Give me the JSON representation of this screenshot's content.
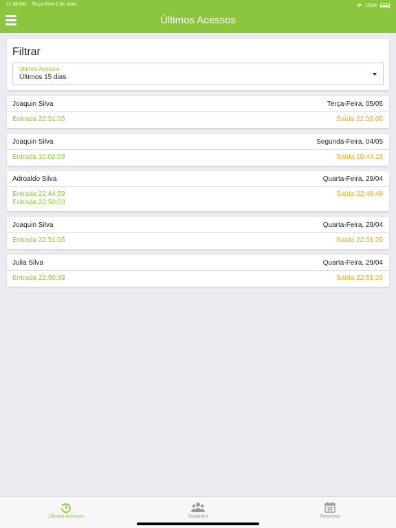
{
  "status_bar": {
    "time": "11:38 AM",
    "date": "Terça-feira 5 de maio",
    "battery": "100%"
  },
  "header": {
    "title": "Últimos Acessos"
  },
  "filter": {
    "title": "Filtrar",
    "field_label": "Últimos Acessos",
    "selected": "Últimos 15 dias"
  },
  "accesses": [
    {
      "name": "Joaquin Silva",
      "date": "Terça-Feira, 05/05",
      "entries": [
        "Entrada 22:51:05"
      ],
      "exit": "Saída 22:55:05"
    },
    {
      "name": "Joaquin Silva",
      "date": "Segunda-Feira, 04/05",
      "entries": [
        "Entrada 10:02:03"
      ],
      "exit": "Saída 10:44:18"
    },
    {
      "name": "Adroaldo Silva",
      "date": "Quarta-Feira, 29/04",
      "entries": [
        "Entrada 22:44:59",
        "Entrada 22:50:03"
      ],
      "exit": "Saída 22:48:48"
    },
    {
      "name": "Joaquin Silva",
      "date": "Quarta-Feira, 29/04",
      "entries": [
        "Entrada 22:51:05"
      ],
      "exit": "Saída 22:51:29"
    },
    {
      "name": "Julia Silva",
      "date": "Quarta-Feira, 29/04",
      "entries": [
        "Entrada 22:50:38"
      ],
      "exit": "Saída 22:51:16"
    }
  ],
  "tabbar": {
    "tabs": [
      {
        "label": "Últimos Acessos",
        "icon": "history-icon",
        "active": true
      },
      {
        "label": "Visitantes",
        "icon": "users-icon",
        "active": false
      },
      {
        "label": "Reservas",
        "icon": "calendar-icon",
        "active": false
      }
    ]
  },
  "colors": {
    "accent": "#8cc63e",
    "exit": "#f5a623",
    "background": "#ebebf0"
  }
}
